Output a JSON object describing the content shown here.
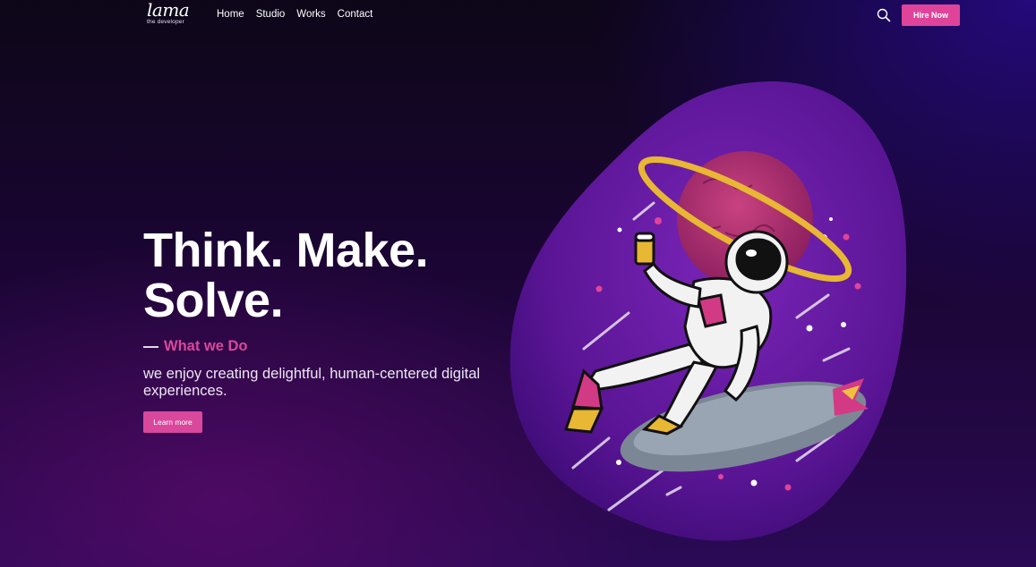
{
  "brand": {
    "logo_text": "lama",
    "logo_subtitle": "the developer"
  },
  "nav": {
    "items": [
      {
        "label": "Home"
      },
      {
        "label": "Studio"
      },
      {
        "label": "Works"
      },
      {
        "label": "Contact"
      }
    ],
    "search_icon": "search-icon",
    "hire_label": "Hire Now"
  },
  "hero": {
    "headline_line1": "Think. Make.",
    "headline_line2": "Solve.",
    "section_label": "What we Do",
    "description": "we enjoy creating delightful, human-centered digital experiences.",
    "cta_label": "Learn more"
  },
  "colors": {
    "accent": "#d9489c",
    "background": "#1a0533",
    "blob": "#6a1fa8"
  }
}
